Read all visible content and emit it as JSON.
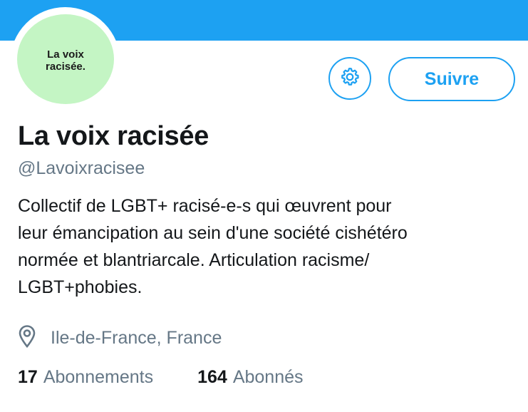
{
  "header": {
    "banner_color": "#1da1f2"
  },
  "profile": {
    "avatar_text": "La voix\nracisée.",
    "avatar_bg": "#c4f5c4",
    "display_name": "La voix racisée",
    "handle": "@Lavoixracisee",
    "bio": "Collectif de LGBT+ racisé-e-s qui œuvrent pour\nleur émancipation au sein d'une société cishétéro\nnormée et blantriarcale. Articulation racisme/\nLGBT+phobies.",
    "location": "Ile-de-France, France",
    "location_icon": "location-pin-icon"
  },
  "actions": {
    "settings_icon": "gear-icon",
    "follow_label": "Suivre",
    "accent": "#1da1f2"
  },
  "stats": {
    "following_count": "17",
    "following_label": "Abonnements",
    "followers_count": "164",
    "followers_label": "Abonnés"
  }
}
